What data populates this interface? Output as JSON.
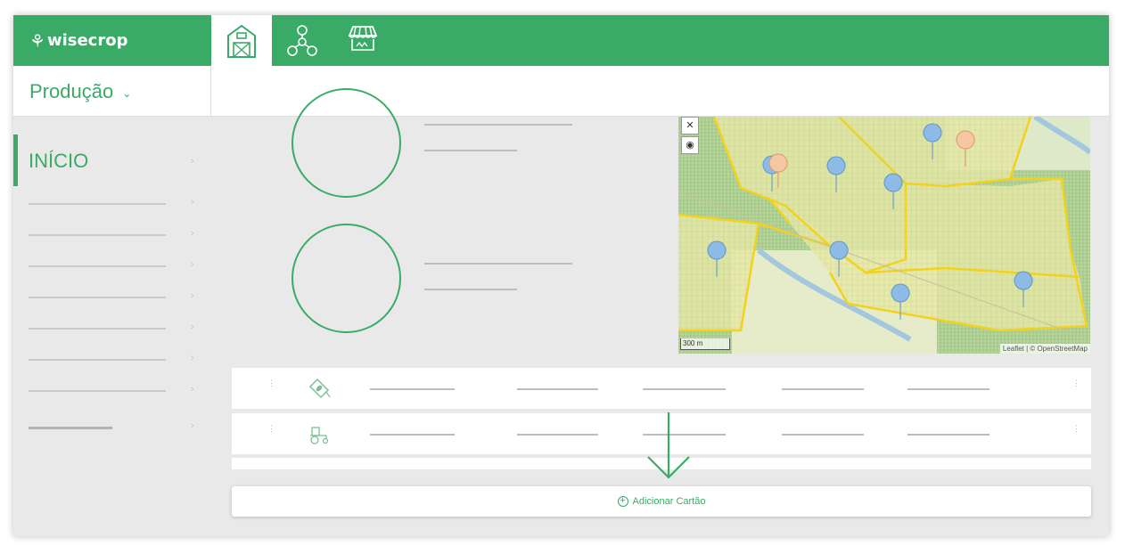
{
  "app": {
    "brand_glyph": "⚘",
    "brand_name": "wisecrop",
    "accent_color": "#3aab66"
  },
  "topnav": [
    {
      "icon": "barn-icon",
      "active": true
    },
    {
      "icon": "network-icon",
      "active": false
    },
    {
      "icon": "market-stall-icon",
      "active": false
    }
  ],
  "subheader": {
    "selector_label": "Produção",
    "selector_caret": "⌄"
  },
  "sidebar": {
    "active_label": "INÍCIO",
    "chevron": "›"
  },
  "map": {
    "scale_label": "300 m",
    "attribution": "Leaflet | © OpenStreetMap",
    "fullscreen_glyph": "✕",
    "locate_glyph": "◉"
  },
  "add_card": {
    "label": "Adicionar Cartão",
    "plus": "+"
  }
}
